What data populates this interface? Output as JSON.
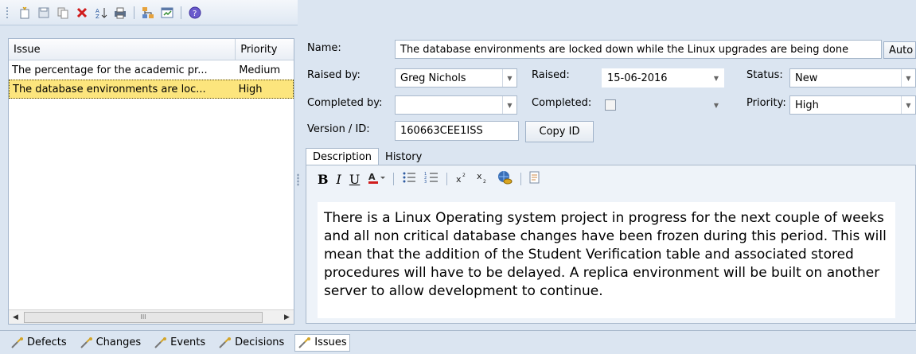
{
  "toolbar": {
    "icons": [
      "new-icon",
      "save-icon",
      "copy-icon",
      "delete-icon",
      "sort-icon",
      "print-icon",
      "hierarchy-icon",
      "properties-icon",
      "help-icon"
    ]
  },
  "list": {
    "col_issue": "Issue",
    "col_priority": "Priority",
    "rows": [
      {
        "issue": "The percentage for the academic pr...",
        "priority": "Medium"
      },
      {
        "issue": "The database environments are loc...",
        "priority": "High"
      }
    ],
    "scroll_mid": "III"
  },
  "form": {
    "name_label": "Name:",
    "name_value": "The database environments are locked down while the Linux upgrades are being done",
    "auto_button": "Auto",
    "raised_by_label": "Raised by:",
    "raised_by_value": "Greg Nichols",
    "raised_label": "Raised:",
    "raised_value": "15-06-2016",
    "status_label": "Status:",
    "status_value": "New",
    "completed_by_label": "Completed by:",
    "completed_by_value": "",
    "completed_label": "Completed:",
    "priority_label": "Priority:",
    "priority_value": "High",
    "version_label": "Version / ID:",
    "version_value": "160663CEE1ISS",
    "copy_id_button": "Copy ID"
  },
  "tabs": {
    "description": "Description",
    "history": "History"
  },
  "editor": {
    "bold": "B",
    "italic": "I",
    "underline": "U",
    "text": "There is a Linux Operating system project in progress for the next couple of weeks and all non critical database changes have been frozen during this period. This will mean that the addition of the Student Verification table and associated stored procedures will have to be delayed. A replica environment will be built on another server to allow development to continue."
  },
  "bottom_tabs": [
    "Defects",
    "Changes",
    "Events",
    "Decisions",
    "Issues"
  ]
}
